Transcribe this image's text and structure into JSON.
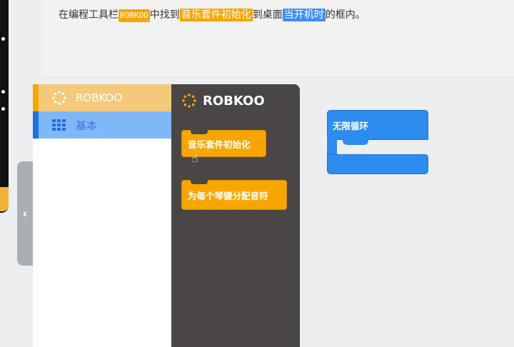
{
  "instruction": {
    "prefix": "在编程工具栏",
    "chip1": "ROBKOO",
    "mid1": "中找到",
    "chip2": "音乐套件初始化",
    "mid2": "到桌面",
    "chip3": "当开机时",
    "suffix": "的框内。"
  },
  "categories": [
    {
      "label": "ROBKOO",
      "icon": "spinner-icon",
      "color": "#f7a600"
    },
    {
      "label": "基本",
      "icon": "grid-icon",
      "color": "#1e6fe0"
    }
  ],
  "flyout": {
    "title": "ROBKOO",
    "blocks": [
      {
        "label": "音乐套件初始化"
      },
      {
        "label": "为每个琴键分配音符"
      }
    ]
  },
  "workspace": {
    "loop_block": {
      "label": "无限循环"
    }
  },
  "colors": {
    "orange": "#f7a600",
    "blue": "#2d8cf0",
    "flyout_bg": "#4a4646"
  }
}
